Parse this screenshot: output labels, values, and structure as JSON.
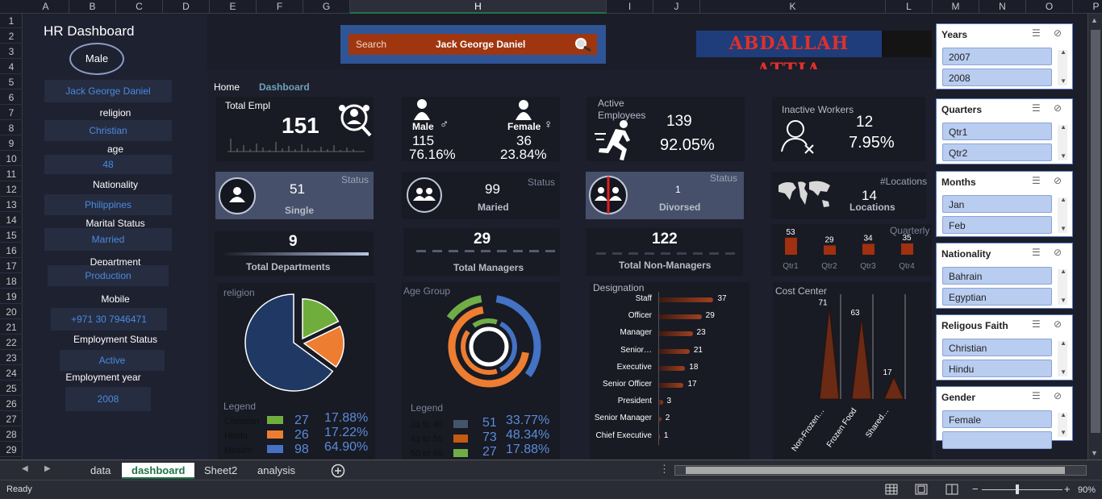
{
  "columns": [
    "A",
    "B",
    "C",
    "D",
    "E",
    "F",
    "G",
    "H",
    "I",
    "J",
    "K",
    "L",
    "M",
    "N",
    "O",
    "P"
  ],
  "rows": [
    "1",
    "2",
    "3",
    "4",
    "5",
    "6",
    "7",
    "8",
    "9",
    "10",
    "11",
    "12",
    "13",
    "14",
    "15",
    "16",
    "17",
    "18",
    "19",
    "20",
    "21",
    "22",
    "23",
    "24",
    "25",
    "26",
    "27",
    "28",
    "29"
  ],
  "left": {
    "title": "HR Dashboard",
    "gender": "Male",
    "name": "Jack George Daniel",
    "religion_label": "religion",
    "religion": "Christian",
    "age_label": "age",
    "age": "48",
    "nationality_label": "Nationality",
    "nationality": "Philippines",
    "marital_label": "Marital Status",
    "marital": "Married",
    "dept_label": "Department",
    "dept": "Production",
    "mobile_label": "Mobile",
    "mobile": "+971 30 7946471",
    "emp_status_label": "Employment Status",
    "emp_status": "Active",
    "emp_year_label": "Employment year",
    "emp_year": "2008"
  },
  "search": {
    "label": "Search",
    "value": "Jack George Daniel"
  },
  "brand": "ABDALLAH ATTIA",
  "nav": {
    "home": "Home",
    "dashboard": "Dashboard"
  },
  "kpi": {
    "total_label": "Total Empl",
    "total": "151",
    "male_label": "Male",
    "male": "115",
    "male_pct": "76.16%",
    "female_label": "Female",
    "female": "36",
    "female_pct": "23.84%",
    "active_label": "Active Employees",
    "active": "139",
    "active_pct": "92.05%",
    "inactive_label": "Inactive Workers",
    "inactive": "12",
    "inactive_pct": "7.95%"
  },
  "status": {
    "label": "Status",
    "single": "51",
    "single_label": "Single",
    "married": "99",
    "married_label": "Maried",
    "divorced": "1",
    "divorced_label": "Divorsed"
  },
  "locations": {
    "label": "#Locations",
    "value": "14",
    "sub": "Locations"
  },
  "counts": {
    "depts": "9",
    "depts_label": "Total Departments",
    "managers": "29",
    "managers_label": "Total Managers",
    "nonmgr": "122",
    "nonmgr_label": "Total Non-Managers"
  },
  "quarterly": {
    "label": "Quarterly",
    "quarters": [
      "Qtr1",
      "Qtr2",
      "Qtr3",
      "Qtr4"
    ],
    "values": [
      53,
      29,
      34,
      35
    ]
  },
  "religion_chart": {
    "title": "religion",
    "legend": "Legend",
    "items": [
      {
        "name": "Christian",
        "count": "27",
        "pct": "17.88%",
        "color": "#6fae3c"
      },
      {
        "name": "Hindu",
        "count": "26",
        "pct": "17.22%",
        "color": "#ed7d31"
      },
      {
        "name": "Muslim",
        "count": "98",
        "pct": "64.90%",
        "color": "#4472c4"
      }
    ]
  },
  "age_chart": {
    "title": "Age Group",
    "legend": "Legend",
    "items": [
      {
        "name": "31 to 40",
        "count": "51",
        "pct": "33.77%",
        "color": "#44546a"
      },
      {
        "name": "41 to 50",
        "count": "73",
        "pct": "48.34%",
        "color": "#c55a11"
      },
      {
        "name": "50 to 60",
        "count": "27",
        "pct": "17.88%",
        "color": "#70ad47"
      }
    ]
  },
  "designation": {
    "title": "Designation",
    "items": [
      {
        "name": "Staff",
        "value": 37
      },
      {
        "name": "Officer",
        "value": 29
      },
      {
        "name": "Manager",
        "value": 23
      },
      {
        "name": "Senior…",
        "value": 21
      },
      {
        "name": "Executive",
        "value": 18
      },
      {
        "name": "Senior Officer",
        "value": 17
      },
      {
        "name": "President",
        "value": 3
      },
      {
        "name": "Senior Manager",
        "value": 2
      },
      {
        "name": "Chief Executive",
        "value": 1
      }
    ]
  },
  "cost_center": {
    "title": "Cost Center",
    "items": [
      {
        "name": "Non-Frozen…",
        "value": 71
      },
      {
        "name": "Frozen Food",
        "value": 63
      },
      {
        "name": "Shared…",
        "value": 17
      }
    ]
  },
  "slicers": [
    {
      "title": "Years",
      "items": [
        "2007",
        "2008"
      ]
    },
    {
      "title": "Quarters",
      "items": [
        "Qtr1",
        "Qtr2"
      ]
    },
    {
      "title": "Months",
      "items": [
        "Jan",
        "Feb"
      ]
    },
    {
      "title": "Nationality",
      "items": [
        "Bahrain",
        "Egyptian"
      ]
    },
    {
      "title": "Religous Faith",
      "items": [
        "Christian",
        "Hindu"
      ]
    },
    {
      "title": "Gender",
      "items": [
        "Female",
        ""
      ]
    }
  ],
  "sheets": [
    "data",
    "dashboard",
    "Sheet2",
    "analysis"
  ],
  "statusbar": {
    "ready": "Ready",
    "zoom": "90%"
  }
}
